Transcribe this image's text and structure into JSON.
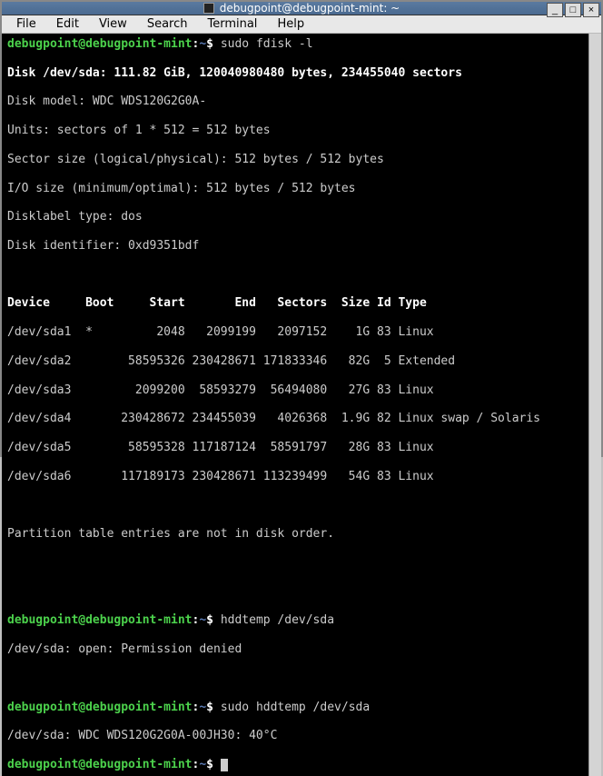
{
  "window": {
    "title": "debugpoint@debugpoint-mint: ~",
    "controls": {
      "min": "_",
      "max": "□",
      "close": "×"
    }
  },
  "menu": {
    "file": "File",
    "edit": "Edit",
    "view": "View",
    "search": "Search",
    "terminal": "Terminal",
    "help": "Help"
  },
  "prompt": {
    "user_host": "debugpoint@debugpoint-mint",
    "sep": ":",
    "path": "~",
    "dollar": "$ "
  },
  "cmd1": "sudo fdisk -l",
  "fdisk": {
    "disk_line": "Disk /dev/sda: 111.82 GiB, 120040980480 bytes, 234455040 sectors",
    "model": "Disk model: WDC WDS120G2G0A-",
    "units": "Units: sectors of 1 * 512 = 512 bytes",
    "sector": "Sector size (logical/physical): 512 bytes / 512 bytes",
    "io": "I/O size (minimum/optimal): 512 bytes / 512 bytes",
    "labeltype": "Disklabel type: dos",
    "identifier": "Disk identifier: 0xd9351bdf",
    "header": "Device     Boot     Start       End   Sectors  Size Id Type",
    "rows": [
      "/dev/sda1  *         2048   2099199   2097152    1G 83 Linux",
      "/dev/sda2        58595326 230428671 171833346   82G  5 Extended",
      "/dev/sda3         2099200  58593279  56494080   27G 83 Linux",
      "/dev/sda4       230428672 234455039   4026368  1.9G 82 Linux swap / Solaris",
      "/dev/sda5        58595328 117187124  58591797   28G 83 Linux",
      "/dev/sda6       117189173 230428671 113239499   54G 83 Linux"
    ],
    "note": "Partition table entries are not in disk order."
  },
  "cmd2": "hddtemp /dev/sda",
  "out2": "/dev/sda: open: Permission denied",
  "cmd3": "sudo hddtemp /dev/sda",
  "out3": "/dev/sda: WDC WDS120G2G0A-00JH30: 40°C"
}
